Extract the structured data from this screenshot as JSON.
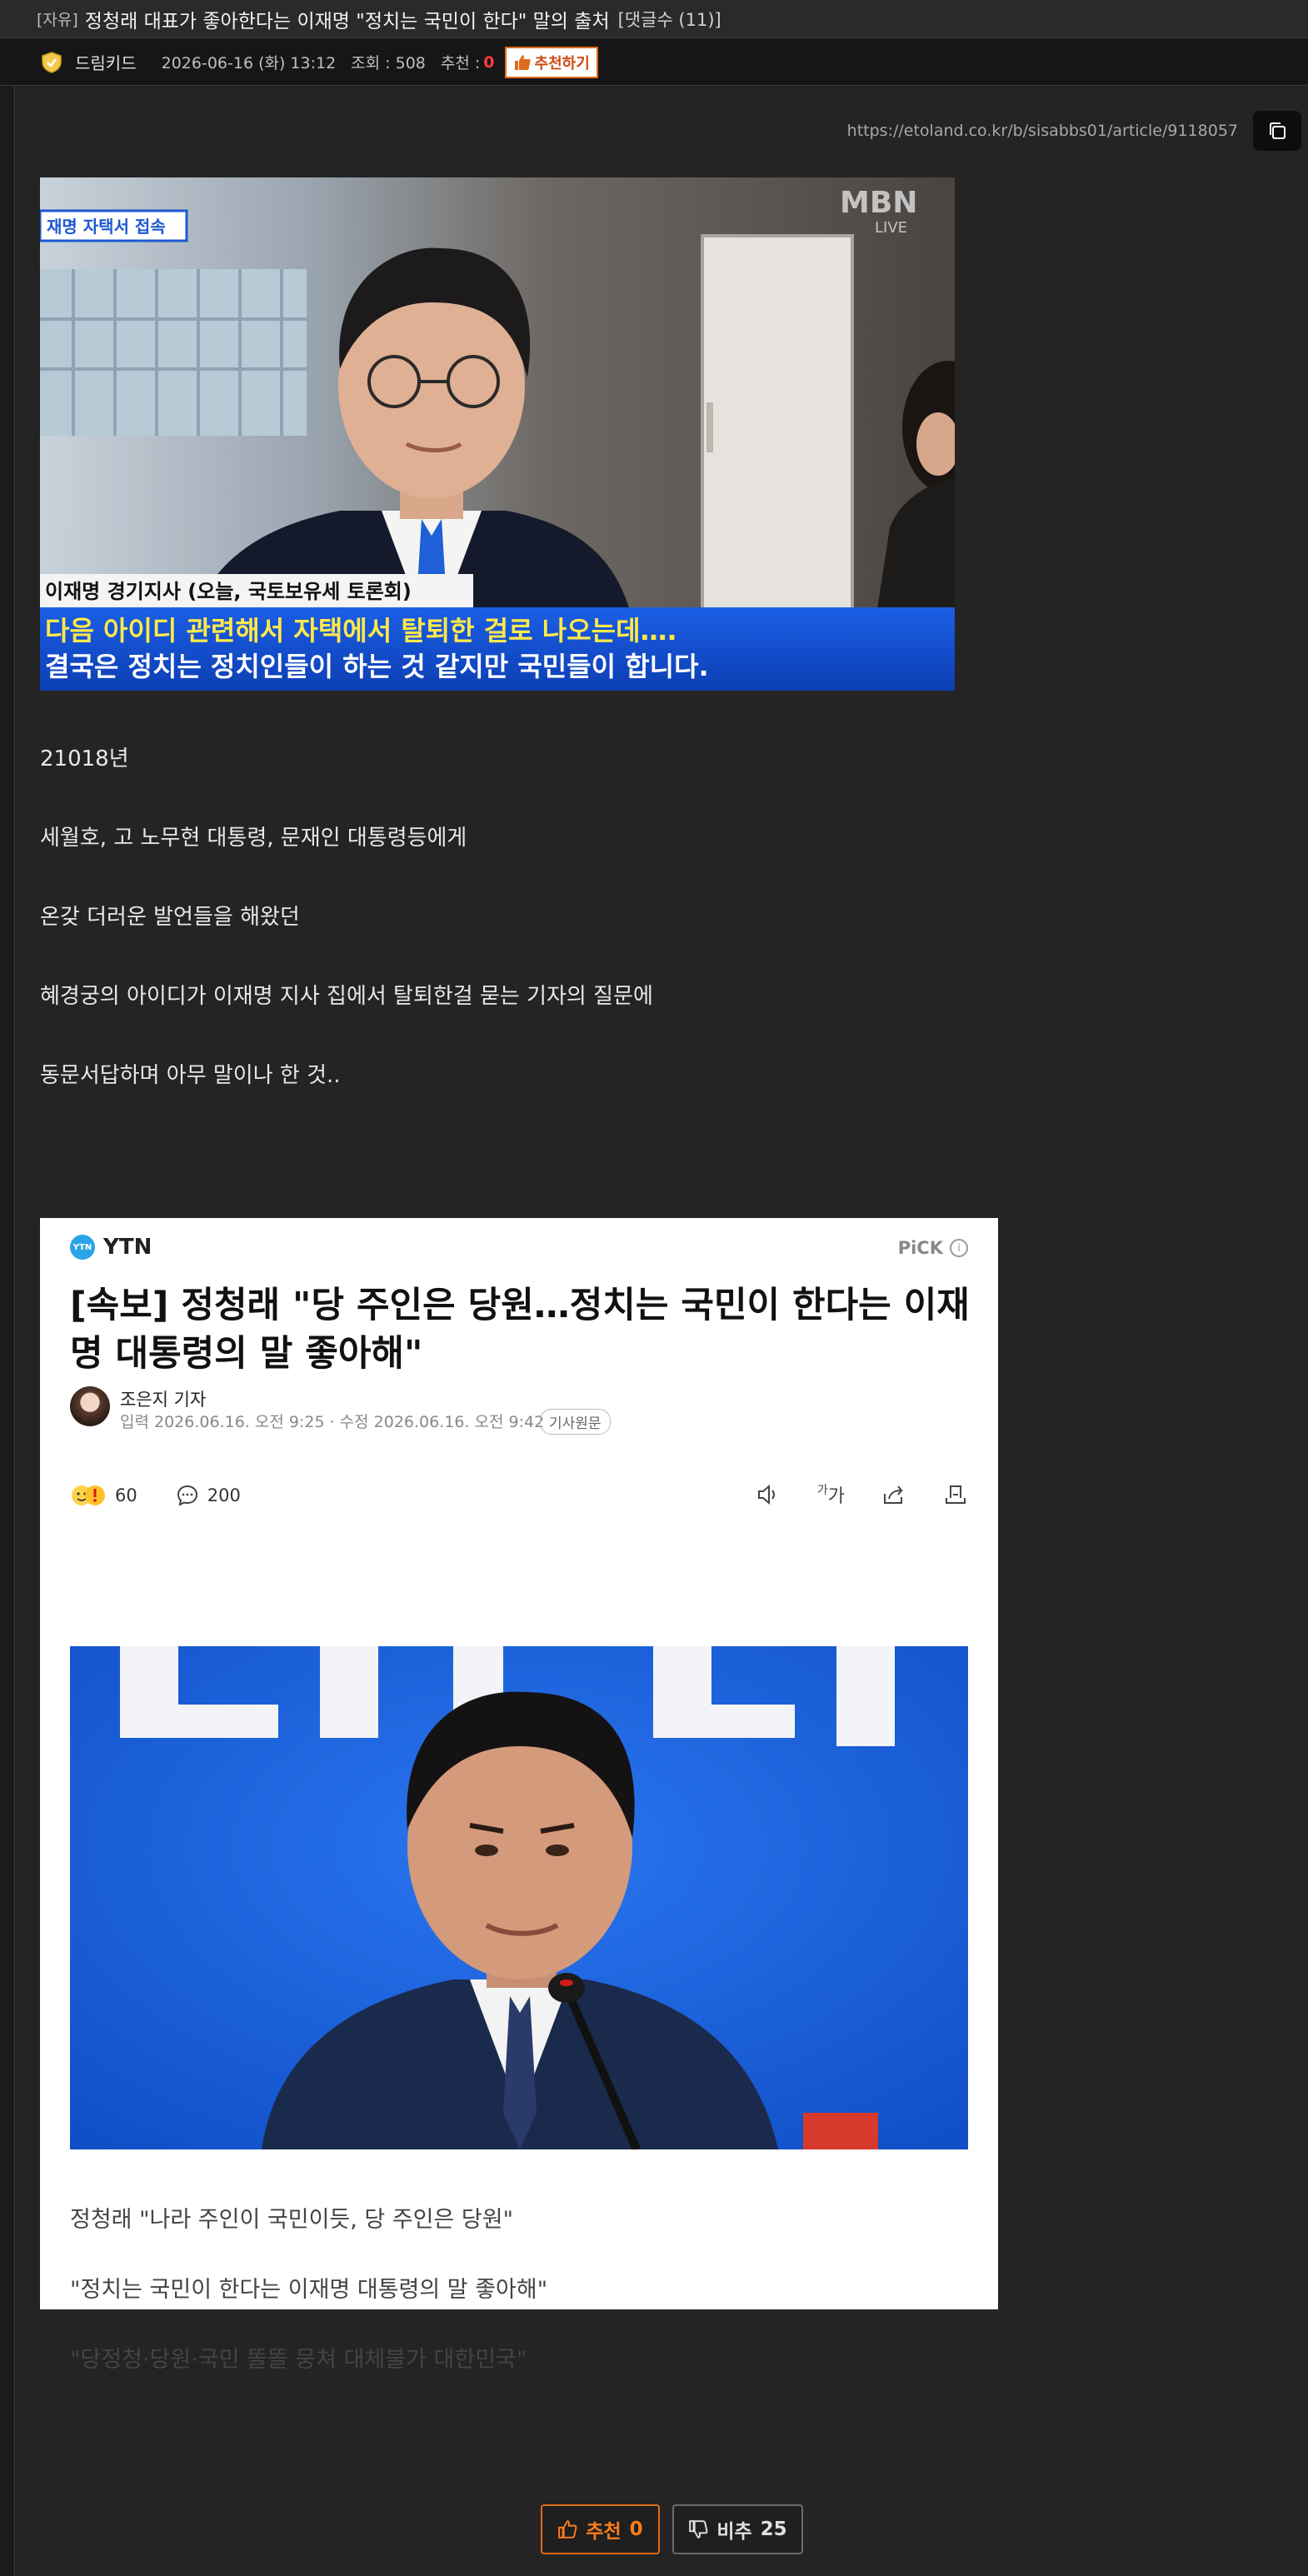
{
  "post": {
    "category": "[자유]",
    "title": "정청래 대표가 좋아한다는 이재명 \"정치는 국민이 한다\" 말의 출처",
    "comment_count": "[댓글수 (11)]"
  },
  "meta": {
    "author": "드림키드",
    "date": "2026-06-16 (화) 13:12",
    "views": "조회 : 508",
    "recommend_label": "추천 :",
    "recommend_count": "0",
    "recommend_button": "추천하기"
  },
  "source": {
    "url": "https://etoland.co.kr/b/sisabbs01/article/9118057"
  },
  "photo1": {
    "caption_label": "재명 자택서 접속",
    "broadcaster": "MBN",
    "broadcaster_sub": "LIVE",
    "speaker": "이재명 경기지사 (오늘, 국토보유세 토론회)",
    "subtitle_1": "다음 아이디 관련해서 자택에서 탈퇴한 걸로 나오는데….",
    "subtitle_2": "결국은 정치는 정치인들이 하는 것 같지만 국민들이 합니다."
  },
  "body": {
    "paragraphs": [
      "21018년",
      "세월호, 고 노무현 대통령, 문재인 대통령등에게",
      "온갖 더러운 발언들을 해왔던",
      "혜경궁의 아이디가 이재명 지사  집에서 탈퇴한걸 묻는 기자의 질문에",
      "동문서답하며 아무 말이나 한 것.."
    ]
  },
  "news_card": {
    "outlet": "YTN",
    "outlet_badge": "YTN",
    "pick": "PiCK",
    "headline": "[속보] 정청래 \"당 주인은 당원…정치는 국민이 한다는 이재명 대통령의 말 좋아해\"",
    "reporter": "조은지 기자",
    "dates": "입력 2026.06.16. 오전 9:25 · 수정 2026.06.16. 오전 9:42",
    "original_button": "기사원문",
    "reactions": "60",
    "comments": "200",
    "font_size_label": "가",
    "captions": [
      "정청래 \"나라 주인이 국민이듯, 당 주인은 당원\"",
      "\"정치는 국민이 한다는 이재명 대통령의 말 좋아해\"",
      "\"당정청·당원·국민 똘똘 뭉쳐 대체불가 대한민국\""
    ]
  },
  "votes": {
    "up_label": "추천",
    "up_count": "0",
    "down_label": "비추",
    "down_count": "25"
  },
  "colors": {
    "background": "#242424",
    "accent": "#e06a1b",
    "recommend_red": "#ff3b3b"
  }
}
